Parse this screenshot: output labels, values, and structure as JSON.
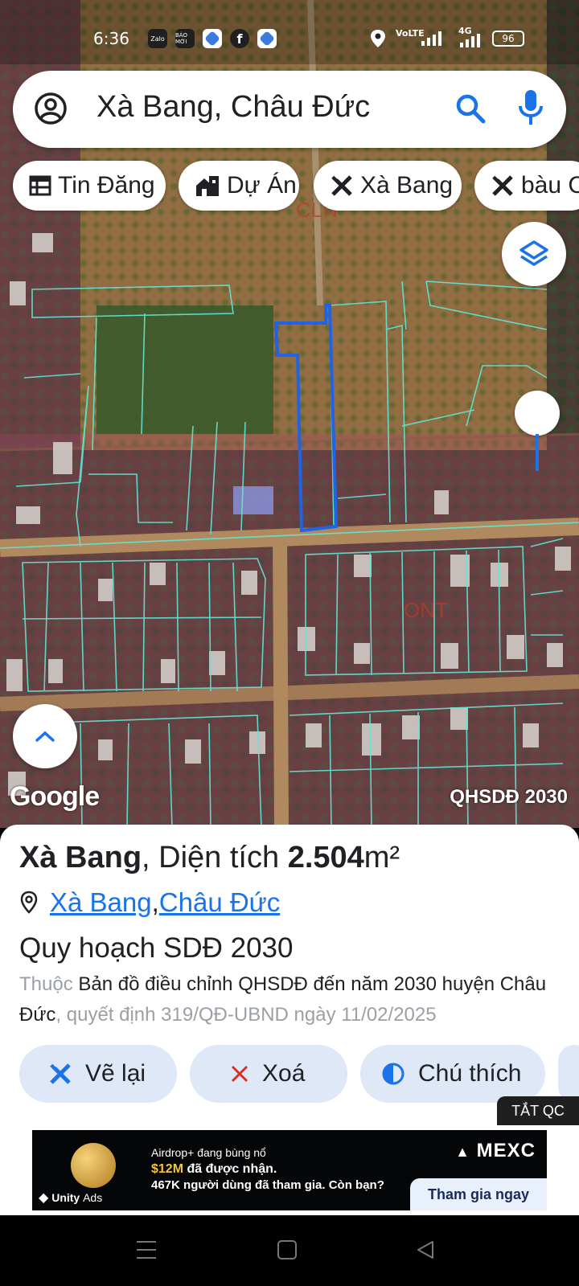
{
  "status_bar": {
    "time": "6:36",
    "notif_apps": [
      "Zalo",
      "BÁO MỚI",
      "app",
      "Facebook",
      "app"
    ],
    "network": "VoLTE",
    "network2": "4G",
    "battery": "96"
  },
  "search": {
    "value": "Xà Bang, Châu Đức"
  },
  "chips": [
    {
      "label": "Tin Đăng",
      "icon": "calendar-grid-icon"
    },
    {
      "label": "Dự Án",
      "icon": "house-building-icon"
    },
    {
      "label": "Xà Bang",
      "icon": "ruler-pencil-icon"
    },
    {
      "label": "bàu C",
      "icon": "ruler-pencil-icon"
    }
  ],
  "map": {
    "google_logo": "Google",
    "layer_label": "QHSDĐ 2030",
    "map_zone_labels": [
      "CLN",
      "ONT"
    ],
    "colors": {
      "parcel_line": "#63e6d6",
      "selected_parcel": "#1f63e6",
      "zone_cln": "#b5863f",
      "zone_ont": "#a04a63"
    }
  },
  "sheet": {
    "title_name": "Xà Bang",
    "title_mid": ", Diện tích ",
    "area_value": "2.504",
    "area_unit": "m²",
    "loc_commune": "Xà Bang",
    "loc_sep": ", ",
    "loc_district": "Châu Đức",
    "plan_title": "Quy hoạch SDĐ 2030",
    "desc_prefix": "Thuộc ",
    "desc_main": "Bản đồ điều chỉnh QHSDĐ đến năm 2030 huyện Châu Đức",
    "desc_suffix": ", quyết định 319/QĐ-UBND ngày 11/02/2025",
    "buttons": [
      {
        "label": "Vẽ lại",
        "icon": "ruler-pencil-icon"
      },
      {
        "label": "Xoá",
        "icon": "close-icon"
      },
      {
        "label": "Chú thích",
        "icon": "half-circle-icon"
      }
    ],
    "ad_close": "TẮT QC"
  },
  "ad": {
    "line1": "Airdrop+ đang bùng nổ",
    "line2_amount": "$12M",
    "line2_rest": " đã được nhận.",
    "line3": "467K người dùng đã tham gia. Còn bạn?",
    "brand": "MEXC",
    "cta": "Tham gia ngay",
    "network_name": "Unity",
    "network_suffix": "Ads"
  }
}
